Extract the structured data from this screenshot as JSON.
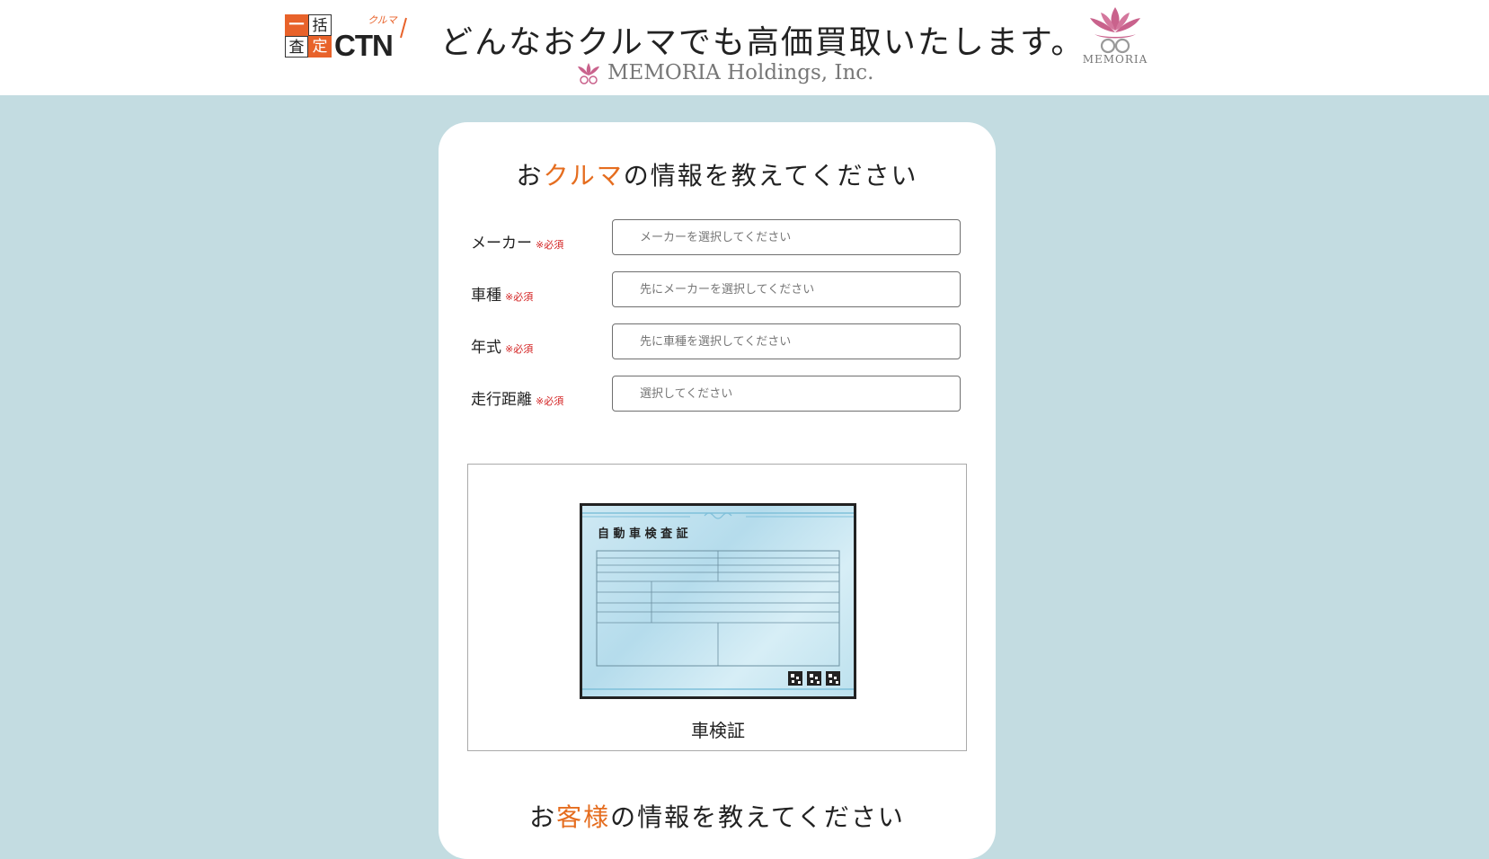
{
  "header": {
    "ctn_logo": {
      "box1": "一",
      "box2": "括",
      "box3": "査",
      "box4": "定",
      "text": "CTN",
      "kuruma": "クルマ"
    },
    "tagline": "どんなおクルマでも高価買取いたします。",
    "memoria_sub": "MEMORIA Holdings, Inc.",
    "memoria_logo_text": "MEMORIA",
    "brand_color": "#e8622a",
    "lotus_color": "#c9628c"
  },
  "car_section": {
    "title_pre": "お",
    "title_accent": "クルマ",
    "title_post": "の情報を教えてください",
    "required_mark": "※必須",
    "fields": [
      {
        "label": "メーカー",
        "placeholder": "メーカーを選択してください"
      },
      {
        "label": "車種",
        "placeholder": "先にメーカーを選択してください"
      },
      {
        "label": "年式",
        "placeholder": "先に車種を選択してください"
      },
      {
        "label": "走行距離",
        "placeholder": "選択してください"
      }
    ],
    "certificate": {
      "header_text": "自 動 車 検 査 証",
      "caption": "車検証"
    }
  },
  "customer_section": {
    "title_pre": "お",
    "title_accent": "客様",
    "title_post": "の情報を教えてください"
  },
  "colors": {
    "background": "#c3dce1",
    "accent": "#e56d1f",
    "required": "#d32222"
  }
}
